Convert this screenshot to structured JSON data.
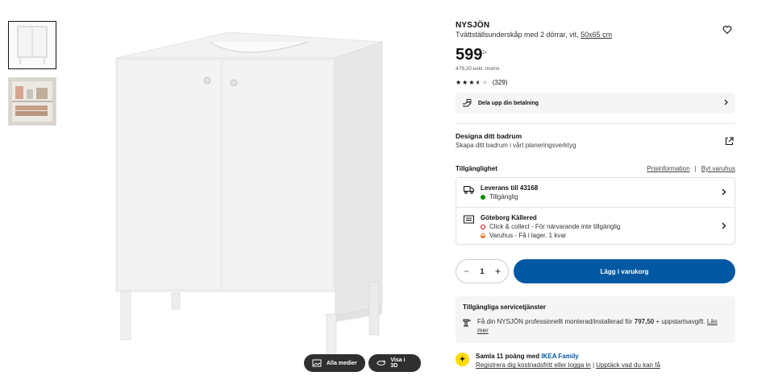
{
  "product": {
    "name": "NYSJÖN",
    "description": "Tvättställsunderskåp med 2 dörrar, vit,",
    "size_link": "50x65 cm",
    "price": "599",
    "price_unit": ":-",
    "price_ex_vat": "479,20 exkl. moms",
    "rating_count": "(329)",
    "rating_value": 3.5
  },
  "payment": {
    "label": "Dela upp din betalning"
  },
  "design": {
    "title": "Designa ditt badrum",
    "subtitle": "Skapa ditt badrum i vårt planeringsverktyg"
  },
  "availability": {
    "title": "Tillgänglighet",
    "price_info_link": "Prisinformation",
    "separator": "|",
    "change_store_link": "Byt varuhus",
    "delivery": {
      "title": "Leverans till 43168",
      "status": "Tillgänglig"
    },
    "store": {
      "title": "Göteborg Källered",
      "click_collect": "Click & collect - För närvarande inte tillgänglig",
      "in_store": "Varuhus - Få i lager. 1 kvar"
    }
  },
  "cart": {
    "quantity": "1",
    "minus": "−",
    "plus": "+",
    "add_label": "Lägg i varukorg"
  },
  "services": {
    "title": "Tillgängliga servicetjänster",
    "text_before": "Få din NYSJÖN professionellt monterad/installerad för",
    "amount": "797,50",
    "text_after": "+ uppstartsavgift.",
    "read_more": "Läs mer"
  },
  "family": {
    "title_prefix": "Samla 11 poäng med",
    "brand": "IKEA Family",
    "register_link": "Registrera dig kostnadsfritt eller logga in",
    "separator": "|",
    "discover_link": "Upptäck vad du kan få"
  },
  "media": {
    "all_media": "Alla medier",
    "view_3d": "Visa i 3D"
  },
  "colors": {
    "accent": "#0058a3",
    "family_yellow": "#ffdb00",
    "in_stock": "#0a8a00"
  }
}
